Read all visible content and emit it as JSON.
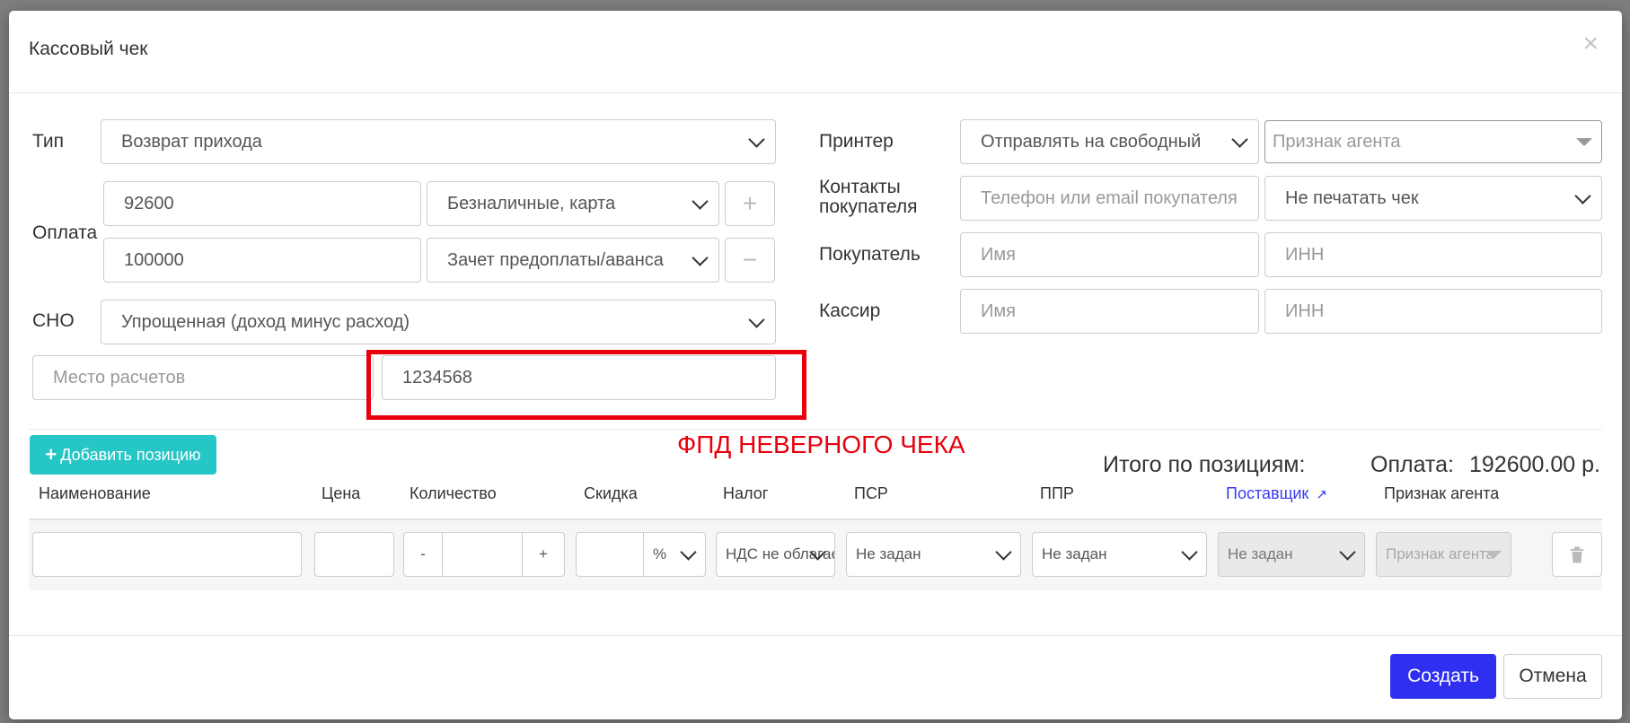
{
  "modal": {
    "title": "Кассовый чек",
    "close_icon": "×"
  },
  "form": {
    "type_label": "Тип",
    "type_value": "Возврат прихода",
    "payment_label": "Оплата",
    "payments": [
      {
        "amount": "92600",
        "method": "Безналичные, карта",
        "button_icon": "+"
      },
      {
        "amount": "100000",
        "method": "Зачет предоплаты/аванса",
        "button_icon": "−"
      }
    ],
    "sno_label": "СНО",
    "sno_value": "Упрощенная (доход минус расход)",
    "place_placeholder": "Место расчетов",
    "fpd_value": "1234568",
    "printer_label": "Принтер",
    "printer_value": "Отправлять на свободный",
    "agent_placeholder": "Признак агента",
    "contacts_label_line1": "Контакты",
    "contacts_label_line2": "покупателя",
    "contacts_placeholder": "Телефон или email покупателя",
    "print_option": "Не печатать чек",
    "buyer_label": "Покупатель",
    "buyer_name_placeholder": "Имя",
    "buyer_inn_placeholder": "ИНН",
    "cashier_label": "Кассир",
    "cashier_name_placeholder": "Имя",
    "cashier_inn_placeholder": "ИНН"
  },
  "annotation": {
    "text": "ФПД НЕВЕРНОГО ЧЕКА",
    "color": "#e8000d"
  },
  "positions": {
    "add_button": "Добавить позицию",
    "total_label": "Итого по позициям:",
    "payment_label": "Оплата:",
    "payment_total": "192600.00 р.",
    "columns": [
      "Наименование",
      "Цена",
      "Количество",
      "Скидка",
      "Налог",
      "ПСР",
      "ППР",
      "Поставщик",
      "Признак агента"
    ],
    "row": {
      "qty_minus": "-",
      "qty_plus": "+",
      "discount_unit": "%",
      "tax": "НДС не облагается",
      "psr": "Не задан",
      "ppr": "Не задан",
      "supplier": "Не задан",
      "agent": "Признак агента"
    }
  },
  "footer": {
    "create": "Создать",
    "cancel": "Отмена"
  },
  "colors": {
    "accent_teal": "#26c6c6",
    "primary_blue": "#2f2ff2",
    "link_blue": "#3a3aee"
  }
}
